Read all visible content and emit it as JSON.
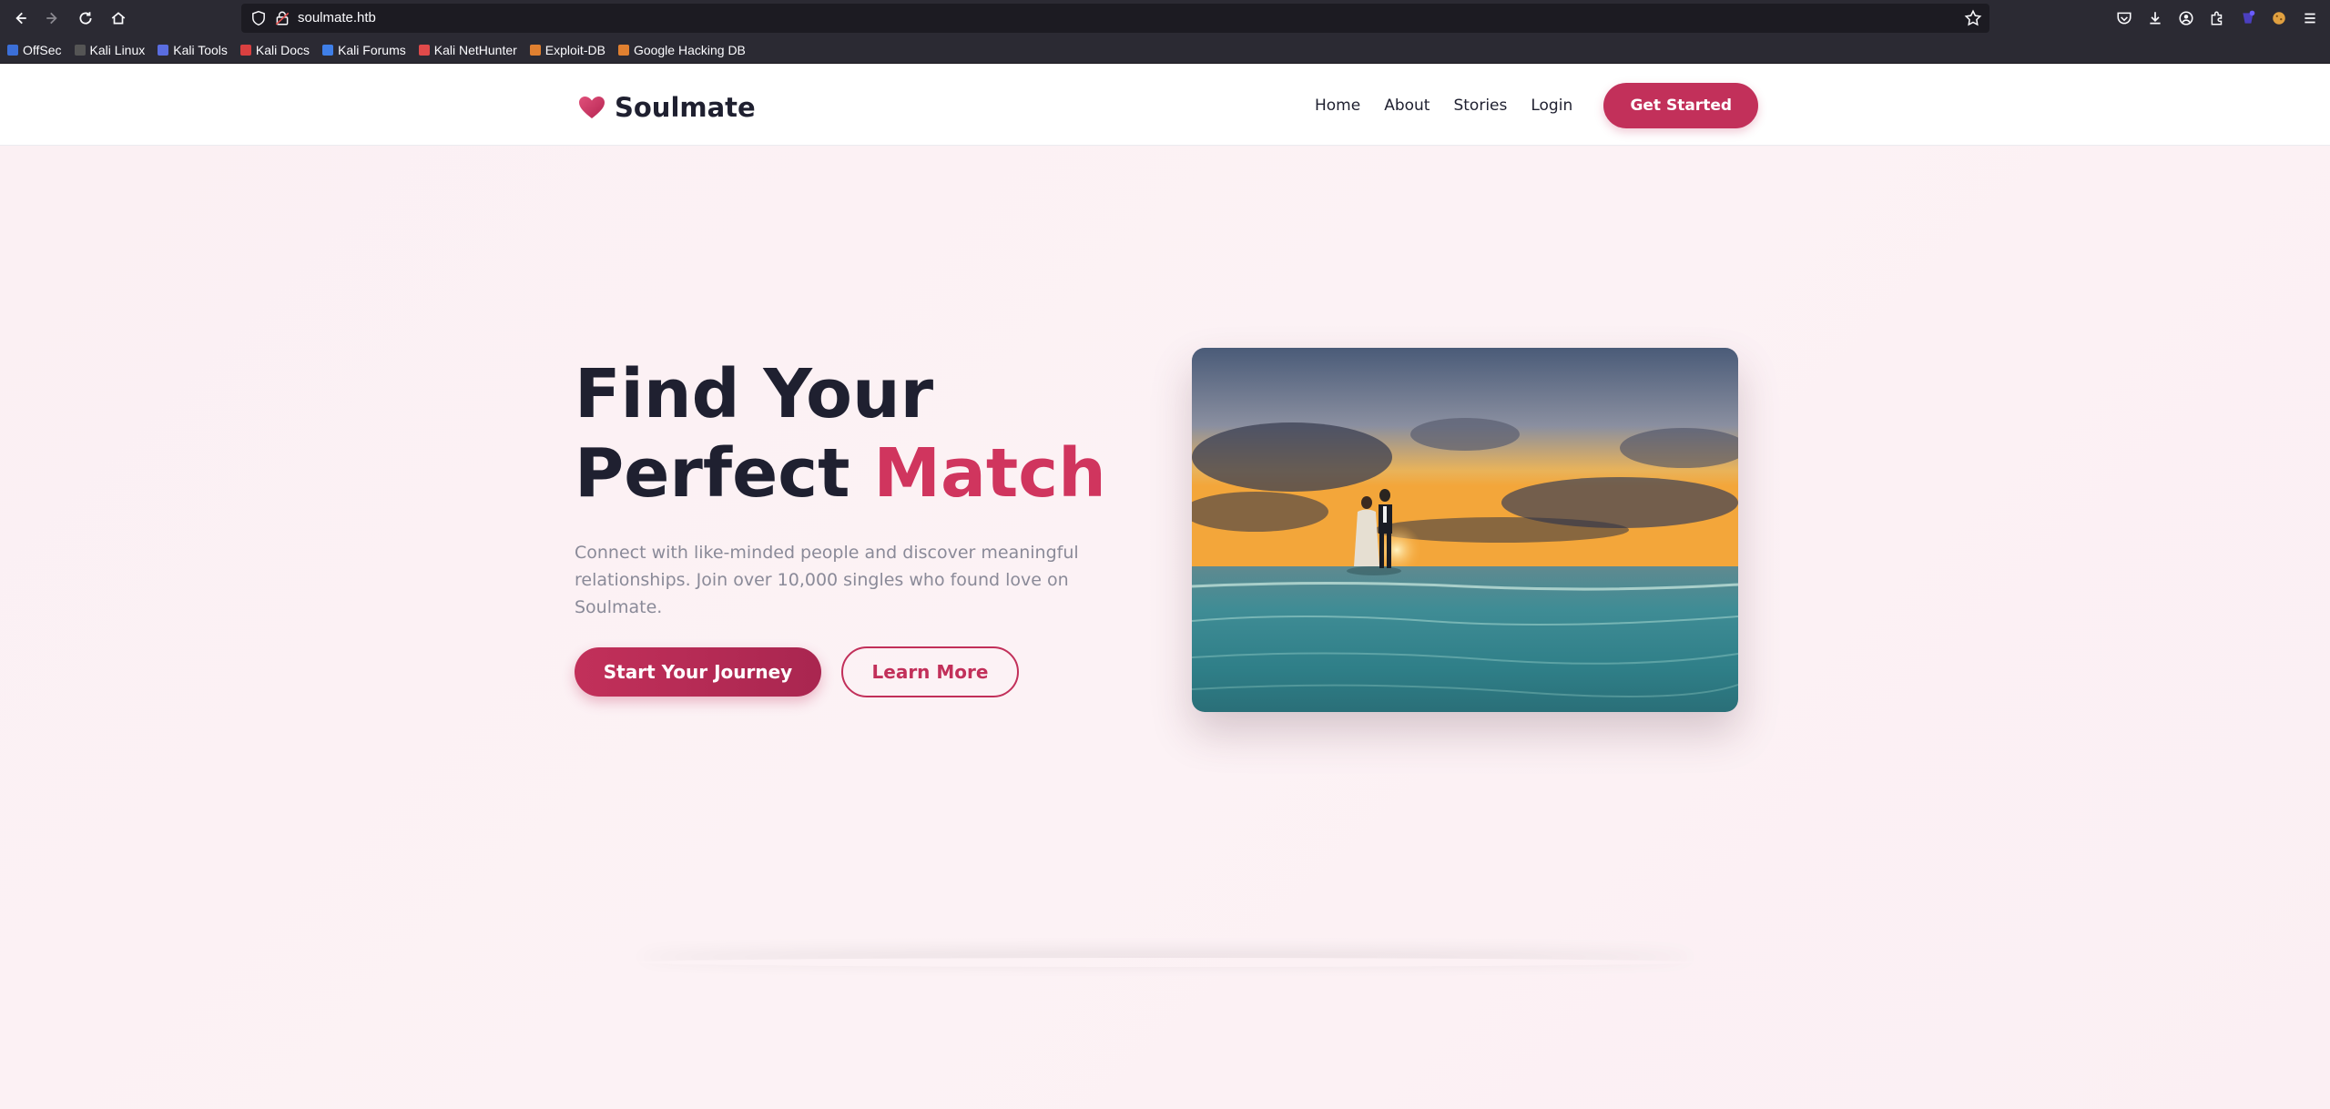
{
  "browser": {
    "url": "soulmate.htb",
    "bookmarks": [
      {
        "label": "OffSec",
        "color": "#3b6fd8"
      },
      {
        "label": "Kali Linux",
        "color": "#2a2a2a"
      },
      {
        "label": "Kali Tools",
        "color": "#5a6de0"
      },
      {
        "label": "Kali Docs",
        "color": "#d94040"
      },
      {
        "label": "Kali Forums",
        "color": "#3f7fe8"
      },
      {
        "label": "Kali NetHunter",
        "color": "#e04a4a"
      },
      {
        "label": "Exploit-DB",
        "color": "#e08030"
      },
      {
        "label": "Google Hacking DB",
        "color": "#e08030"
      }
    ]
  },
  "header": {
    "brand": "Soulmate",
    "nav": {
      "home": "Home",
      "about": "About",
      "stories": "Stories",
      "login": "Login",
      "cta": "Get Started"
    }
  },
  "hero": {
    "title_line1": "Find Your",
    "title_line2_plain": "Perfect ",
    "title_line2_accent": "Match",
    "description": "Connect with like-minded people and discover meaningful relationships. Join over 10,000 singles who found love on Soulmate.",
    "primary_button": "Start Your Journey",
    "secondary_button": "Learn More",
    "image_icon": "couple-beach-sunset-photo"
  },
  "colors": {
    "accent": "#c2305a",
    "accent_text": "#d0355e",
    "dark_text": "#1f2030",
    "muted_text": "#8a8a98"
  }
}
